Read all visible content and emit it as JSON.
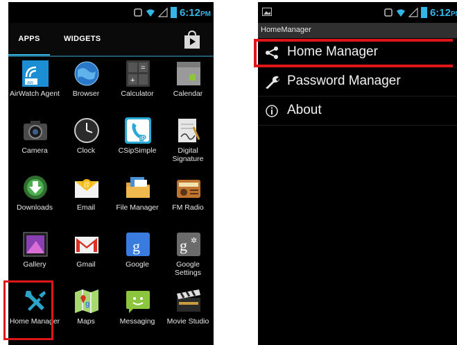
{
  "left": {
    "status": {
      "time": "6:12",
      "ampm": "PM"
    },
    "tabs": {
      "apps": "APPS",
      "widgets": "WIDGETS"
    },
    "apps": [
      {
        "label": "AirWatch Agent",
        "icon": "airwatch-icon"
      },
      {
        "label": "Browser",
        "icon": "globe-icon"
      },
      {
        "label": "Calculator",
        "icon": "calculator-icon"
      },
      {
        "label": "Calendar",
        "icon": "calendar-icon"
      },
      {
        "label": "Camera",
        "icon": "camera-icon"
      },
      {
        "label": "Clock",
        "icon": "clock-icon"
      },
      {
        "label": "CSipSimple",
        "icon": "phone-ip-icon"
      },
      {
        "label": "Digital Signature",
        "icon": "signature-icon"
      },
      {
        "label": "Downloads",
        "icon": "download-icon"
      },
      {
        "label": "Email",
        "icon": "email-icon"
      },
      {
        "label": "File Manager",
        "icon": "file-manager-icon"
      },
      {
        "label": "FM Radio",
        "icon": "radio-icon"
      },
      {
        "label": "Gallery",
        "icon": "gallery-icon"
      },
      {
        "label": "Gmail",
        "icon": "gmail-icon"
      },
      {
        "label": "Google",
        "icon": "google-icon"
      },
      {
        "label": "Google Settings",
        "icon": "google-settings-icon"
      },
      {
        "label": "Home Manager",
        "icon": "tools-icon"
      },
      {
        "label": "Maps",
        "icon": "maps-icon"
      },
      {
        "label": "Messaging",
        "icon": "messaging-icon"
      },
      {
        "label": "Movie Studio",
        "icon": "clapper-icon"
      }
    ]
  },
  "right": {
    "status": {
      "time": "6:12",
      "ampm": "PM"
    },
    "action_bar": {
      "title": "HomeManager"
    },
    "menu": [
      {
        "label": "Home Manager",
        "icon": "share-icon"
      },
      {
        "label": "Password Manager",
        "icon": "wrench-icon"
      },
      {
        "label": "About",
        "icon": "info-icon"
      }
    ]
  },
  "colors": {
    "accent": "#33b5e5",
    "highlight": "#e0151a"
  }
}
